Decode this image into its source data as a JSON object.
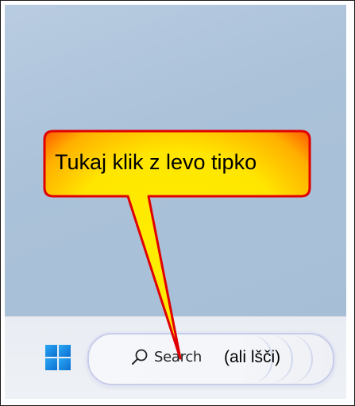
{
  "taskbar": {
    "start_icon": "windows-logo-icon",
    "search": {
      "icon": "search-icon",
      "label": "Search",
      "hint": "(ali lšči)"
    }
  },
  "callout": {
    "text": "Tukaj klik z levo tipko",
    "fill_color": "#ffee00",
    "edge_color": "#ff3300",
    "outline_color": "#e00000"
  },
  "colors": {
    "accent_blue": "#1a8fe0"
  }
}
